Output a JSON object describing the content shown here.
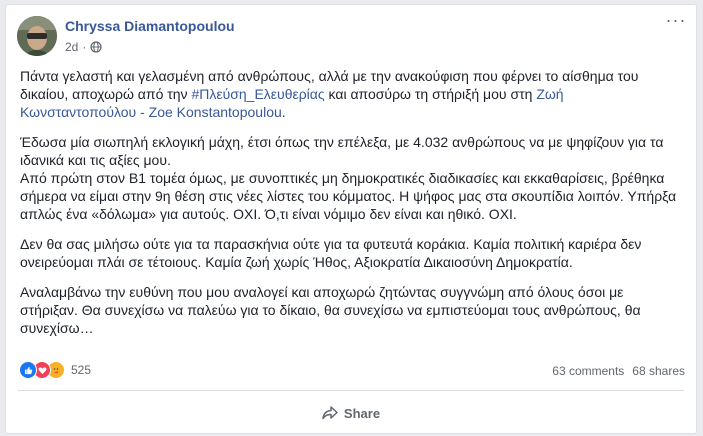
{
  "post": {
    "author": "Chryssa Diamantopoulou",
    "time": "2d",
    "privacy_icon": "globe-icon",
    "paragraphs": [
      {
        "parts": [
          {
            "text": "Πάντα γελαστή και γελασμένη από ανθρώπους, αλλά με την ανακούφιση που φέρνει το αίσθημα του δικαίου, αποχωρώ από την ",
            "link": false
          },
          {
            "text": "#Πλεύση_Ελευθερίας",
            "link": true
          },
          {
            "text": " και αποσύρω τη στήριξή μου στη ",
            "link": false
          },
          {
            "text": "Ζωή Κωνσταντοπούλου - Zoe Konstantopoulou",
            "link": true
          },
          {
            "text": ".",
            "link": false
          }
        ]
      },
      {
        "parts": [
          {
            "text": "Έδωσα μία σιωπηλή εκλογική μάχη, έτσι όπως την επέλεξα, με 4.032 ανθρώπους να με ψηφίζουν για τα ιδανικά και τις αξίες μου.",
            "link": false
          }
        ],
        "tight": true
      },
      {
        "parts": [
          {
            "text": "Από πρώτη στον Β1 τομέα όμως, με συνοπτικές μη δημοκρατικές διαδικασίες και εκκαθαρίσεις, βρέθηκα σήμερα να είμαι στην 9η θέση στις νέες λίστες του κόμματος. Η ψήφος μας στα σκουπίδια λοιπόν. Υπήρξα απλώς ένα «δόλωμα» για αυτούς. ΟΧΙ. Ό,τι είναι νόμιμο δεν είναι και ηθικό. ΟΧΙ.",
            "link": false
          }
        ]
      },
      {
        "parts": [
          {
            "text": "Δεν θα σας μιλήσω ούτε για τα παρασκήνια ούτε για τα φυτευτά κοράκια. Καμία πολιτική καριέρα δεν ονειρεύομαι πλάι σε τέτοιους. Καμία ζωή χωρίς Ήθος, Αξιοκρατία Δικαιοσύνη Δημοκρατία.",
            "link": false
          }
        ]
      },
      {
        "parts": [
          {
            "text": "Αναλαμβάνω την ευθύνη που μου αναλογεί και αποχωρώ ζητώντας συγγνώμη από όλους όσοι με στήριξαν. Θα συνεχίσω να παλεύω για το δίκαιο, θα συνεχίσω να εμπιστεύομαι τους ανθρώπους, θα συνεχίσω…",
            "link": false
          }
        ]
      }
    ],
    "reaction_count": "525",
    "comments": "63 comments",
    "shares": "68 shares",
    "share_label": "Share",
    "more_label": "···"
  }
}
